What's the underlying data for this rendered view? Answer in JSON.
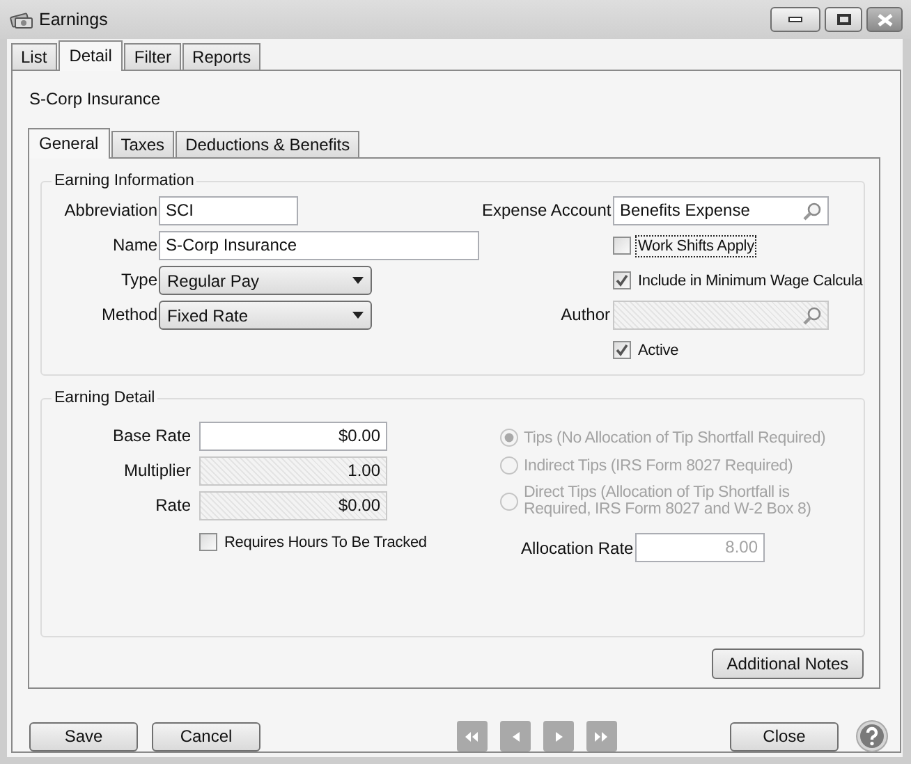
{
  "window": {
    "title": "Earnings"
  },
  "tabs": [
    {
      "label": "List",
      "selected": false
    },
    {
      "label": "Detail",
      "selected": true
    },
    {
      "label": "Filter",
      "selected": false
    },
    {
      "label": "Reports",
      "selected": false
    }
  ],
  "record_title": "S-Corp Insurance",
  "sub_tabs": [
    {
      "label": "General",
      "selected": true
    },
    {
      "label": "Taxes",
      "selected": false
    },
    {
      "label": "Deductions & Benefits",
      "selected": false
    }
  ],
  "earning_information": {
    "title": "Earning Information",
    "left": [
      {
        "kind": "text",
        "label": "Abbreviation",
        "value": "SCI"
      },
      {
        "kind": "text",
        "label": "Name",
        "value": "S-Corp Insurance"
      },
      {
        "kind": "dropdown",
        "label": "Type",
        "value": "Regular Pay"
      },
      {
        "kind": "dropdown",
        "label": "Method",
        "value": "Fixed Rate"
      }
    ],
    "right": [
      {
        "kind": "lookup",
        "label": "Expense Account",
        "value": "Benefits Expense",
        "read_only": false
      },
      {
        "kind": "checkbox",
        "label": "Work Shifts Apply",
        "checked": false,
        "focused": true
      },
      {
        "kind": "checkbox",
        "label": "Include in Minimum Wage Calcula",
        "checked": true
      },
      {
        "kind": "lookup",
        "label": "Author",
        "read_only": true
      },
      {
        "kind": "checkbox",
        "label": "Active",
        "checked": true
      }
    ]
  },
  "earning_detail": {
    "title": "Earning Detail",
    "fields": [
      {
        "label": "Base Rate",
        "value": "$0.00",
        "read_only": false
      },
      {
        "label": "Multiplier",
        "value": "1.00",
        "read_only": true
      },
      {
        "label": "Rate",
        "value": "$0.00",
        "read_only": true
      }
    ],
    "requires_hours": {
      "label": "Requires Hours To Be Tracked",
      "checked": false
    },
    "tip_options": [
      {
        "label": "Tips (No Allocation of Tip Shortfall Required)",
        "selected": true,
        "disabled": true
      },
      {
        "label": "Indirect Tips (IRS Form 8027 Required)",
        "selected": false,
        "disabled": true
      },
      {
        "label": "Direct Tips (Allocation of Tip Shortfall is Required, IRS Form 8027 and W-2 Box 8)",
        "selected": false,
        "disabled": true
      }
    ],
    "allocation_rate": {
      "label": "Allocation Rate",
      "value": "8.00",
      "disabled": true
    }
  },
  "additional_notes_button": "Additional Notes",
  "footer": {
    "left_buttons": [
      "Save",
      "Cancel"
    ],
    "right_button": "Close"
  }
}
